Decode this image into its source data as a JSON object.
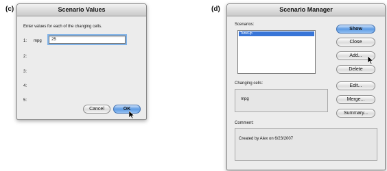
{
  "panel_c": {
    "label": "(c)",
    "title": "Scenario Values",
    "instruction": "Enter values for each of the changing cells.",
    "rows": [
      {
        "num": "1:",
        "cell": "mpg",
        "value": "25"
      },
      {
        "num": "2:"
      },
      {
        "num": "3:"
      },
      {
        "num": "4:"
      },
      {
        "num": "5:"
      }
    ],
    "cancel_label": "Cancel",
    "ok_label": "OK"
  },
  "panel_d": {
    "label": "(d)",
    "title": "Scenario Manager",
    "scenarios_label": "Scenarios:",
    "scenarios": [
      "TuneUp"
    ],
    "buttons": {
      "show": "Show",
      "close": "Close",
      "add": "Add...",
      "delete": "Delete",
      "edit": "Edit...",
      "merge": "Merge...",
      "summary": "Summary..."
    },
    "changing_cells_label": "Changing cells:",
    "changing_cells_value": "mpg",
    "comment_label": "Comment:",
    "comment_value": "Created by Alex on 6/23/2007"
  },
  "colors": {
    "default_button": "#5e9be3",
    "selection": "#3875d7"
  }
}
